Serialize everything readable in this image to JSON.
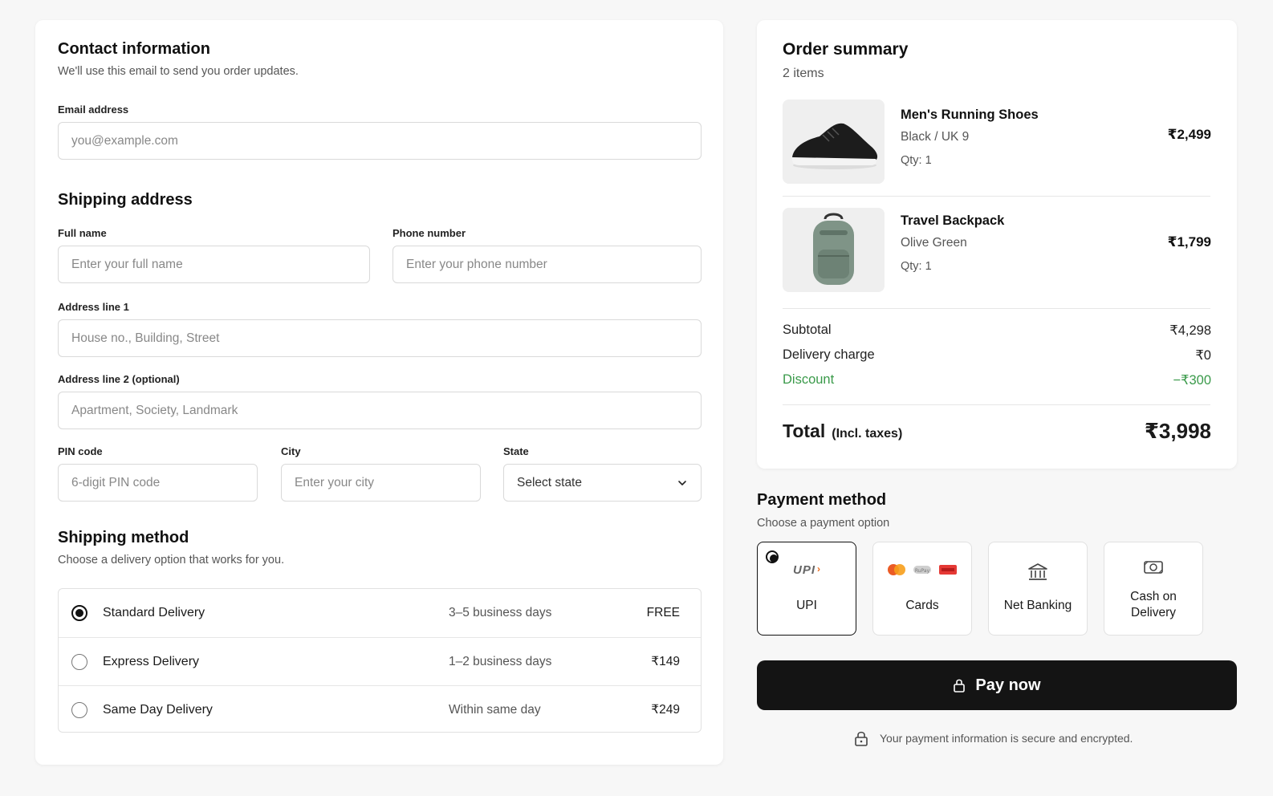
{
  "contact": {
    "title": "Contact information",
    "subtitle": "We'll use this email to send you order updates.",
    "email_label": "Email address",
    "email_placeholder": "you@example.com"
  },
  "shipping_address": {
    "title": "Shipping address",
    "full_name_label": "Full name",
    "full_name_placeholder": "Enter your full name",
    "phone_label": "Phone number",
    "phone_placeholder": "Enter your phone number",
    "address1_label": "Address line 1",
    "address1_placeholder": "House no., Building, Street",
    "address2_label": "Address line 2 (optional)",
    "address2_placeholder": "Apartment, Society, Landmark",
    "pin_label": "PIN code",
    "pin_placeholder": "6-digit PIN code",
    "city_label": "City",
    "city_placeholder": "Enter your city",
    "state_label": "State",
    "state_value": "Select state"
  },
  "shipping_method": {
    "title": "Shipping method",
    "subtitle": "Choose a delivery option that works for you.",
    "options": [
      {
        "name": "Standard Delivery",
        "time": "3–5 business days",
        "price": "FREE",
        "selected": true
      },
      {
        "name": "Express Delivery",
        "time": "1–2 business days",
        "price": "₹149",
        "selected": false
      },
      {
        "name": "Same Day Delivery",
        "time": "Within same day",
        "price": "₹249",
        "selected": false
      }
    ]
  },
  "order_summary": {
    "title": "Order summary",
    "item_count": "2 items",
    "items": [
      {
        "name": "Men's Running Shoes",
        "variant": "Black / UK 9",
        "qty": "Qty: 1",
        "price": "₹2,499",
        "icon": "shoe-image"
      },
      {
        "name": "Travel Backpack",
        "variant": "Olive Green",
        "qty": "Qty: 1",
        "price": "₹1,799",
        "icon": "backpack-image"
      }
    ],
    "subtotal_label": "Subtotal",
    "subtotal_value": "₹4,298",
    "delivery_label": "Delivery charge",
    "delivery_value": "₹0",
    "discount_label": "Discount",
    "discount_value": "−₹300",
    "total_label": "Total",
    "total_note": "(Incl. taxes)",
    "total_value": "₹3,998"
  },
  "payment": {
    "title": "Payment method",
    "subtitle": "Choose a payment option",
    "options": [
      {
        "label": "UPI",
        "logo_text": "UPI",
        "icon": "upi-logo",
        "selected": true
      },
      {
        "label": "Cards",
        "icon": "card-brands-icon",
        "selected": false
      },
      {
        "label": "Net Banking",
        "icon": "bank-icon",
        "selected": false
      },
      {
        "label": "Cash on Delivery",
        "icon": "cash-icon",
        "selected": false
      }
    ],
    "pay_label": "Pay now",
    "secure_note": "Your payment information is secure and encrypted."
  },
  "colors": {
    "discount": "#3a9a4a",
    "pay_button": "#141414",
    "background": "#f7f7f7"
  }
}
